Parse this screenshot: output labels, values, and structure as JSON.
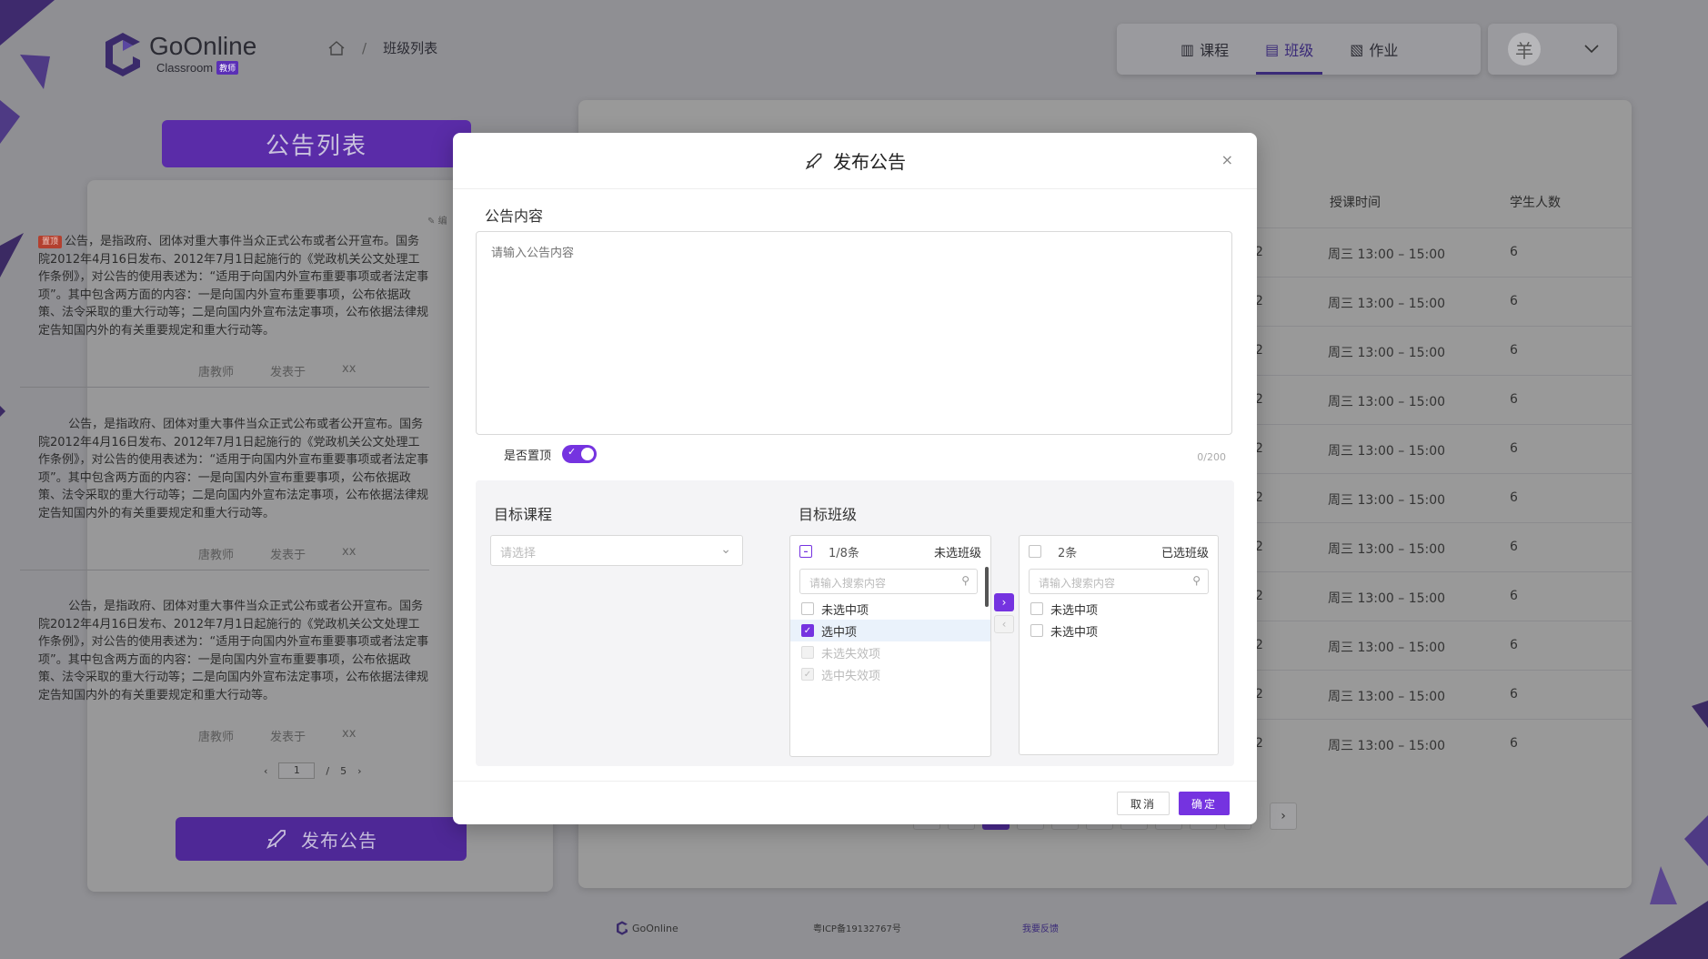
{
  "brand": {
    "name": "GoOnline",
    "sub": "Classroom",
    "role": "教师"
  },
  "breadcrumb": {
    "current": "班级列表"
  },
  "nav": {
    "tabs": [
      {
        "label": "课程",
        "icon": "book-icon"
      },
      {
        "label": "班级",
        "icon": "class-icon",
        "active": true
      },
      {
        "label": "作业",
        "icon": "homework-icon"
      }
    ],
    "avatar_glyph": "羊"
  },
  "left": {
    "title": "公告列表",
    "pinned_label": "置顶",
    "edit_label": "编",
    "items": [
      {
        "pinned": true,
        "text": "公告，是指政府、团体对重大事件当众正式公布或者公开宣布。国务院2012年4月16日发布、2012年7月1日起施行的《党政机关公文处理工作条例》，对公告的使用表述为：“适用于向国内外宣布重要事项或者法定事项”。其中包含两方面的内容：一是向国内外宣布重要事项，公布依据政策、法令采取的重大行动等；二是向国内外宣布法定事项，公布依据法律规定告知国内外的有关重要规定和重大行动等。",
        "author": "唐教师",
        "posted_label": "发表于",
        "time": "xx"
      },
      {
        "pinned": false,
        "text": "        公告，是指政府、团体对重大事件当众正式公布或者公开宣布。国务院2012年4月16日发布、2012年7月1日起施行的《党政机关公文处理工作条例》，对公告的使用表述为：“适用于向国内外宣布重要事项或者法定事项”。其中包含两方面的内容：一是向国内外宣布重要事项，公布依据政策、法令采取的重大行动等；二是向国内外宣布法定事项，公布依据法律规定告知国内外的有关重要规定和重大行动等。",
        "author": "唐教师",
        "posted_label": "发表于",
        "time": "xx"
      },
      {
        "pinned": false,
        "text": "        公告，是指政府、团体对重大事件当众正式公布或者公开宣布。国务院2012年4月16日发布、2012年7月1日起施行的《党政机关公文处理工作条例》，对公告的使用表述为：“适用于向国内外宣布重要事项或者法定事项”。其中包含两方面的内容：一是向国内外宣布重要事项，公布依据政策、法令采取的重大行动等；二是向国内外宣布法定事项，公布依据法律规定告知国内外的有关重要规定和重大行动等。",
        "author": "唐教师",
        "posted_label": "发表于",
        "time": "xx"
      }
    ],
    "pager": {
      "current": "1",
      "sep": "/",
      "total": "5"
    },
    "publish_label": "发布公告"
  },
  "right": {
    "columns": [
      "授课时间",
      "学生人数"
    ],
    "rows": [
      {
        "c0": "2",
        "time": "周三 13:00 – 15:00",
        "count": "6"
      },
      {
        "c0": "2",
        "time": "周三 13:00 – 15:00",
        "count": "6"
      },
      {
        "c0": "2",
        "time": "周三 13:00 – 15:00",
        "count": "6"
      },
      {
        "c0": "2",
        "time": "周三 13:00 – 15:00",
        "count": "6"
      },
      {
        "c0": "2",
        "time": "周三 13:00 – 15:00",
        "count": "6"
      },
      {
        "c0": "2",
        "time": "周三 13:00 – 15:00",
        "count": "6"
      },
      {
        "c0": "2",
        "time": "周三 13:00 – 15:00",
        "count": "6"
      },
      {
        "c0": "2",
        "time": "周三 13:00 – 15:00",
        "count": "6"
      },
      {
        "c0": "2",
        "time": "周三 13:00 – 15:00",
        "count": "6"
      },
      {
        "c0": "2",
        "time": "周三 13:00 – 15:00",
        "count": "6"
      },
      {
        "c0": "2",
        "time": "周三 13:00 – 15:00",
        "count": "6"
      }
    ]
  },
  "footer": {
    "brand": "GoOnline",
    "icp": "粤ICP备19132767号",
    "feedback": "我要反馈"
  },
  "modal": {
    "title": "发布公告",
    "close": "×",
    "content_label": "公告内容",
    "content_placeholder": "请输入公告内容",
    "pin_label": "是否置顶",
    "pin_on": true,
    "counter": "0/200",
    "course_label": "目标课程",
    "course_placeholder": "请选择",
    "class_label": "目标班级",
    "source": {
      "count": "1/8条",
      "title": "未选班级",
      "search_placeholder": "请输入搜索内容",
      "items": [
        {
          "label": "未选中项",
          "state": "off"
        },
        {
          "label": "选中项",
          "state": "on"
        },
        {
          "label": "未选失效项",
          "state": "disabled"
        },
        {
          "label": "选中失效项",
          "state": "disabled-on"
        }
      ]
    },
    "target": {
      "count": "2条",
      "title": "已选班级",
      "search_placeholder": "请输入搜索内容",
      "items": [
        {
          "label": "未选中项",
          "state": "off"
        },
        {
          "label": "未选中项",
          "state": "off"
        }
      ]
    },
    "cancel_label": "取消",
    "ok_label": "确定"
  },
  "colors": {
    "accent": "#7533e0",
    "brand_dark": "#4e2896",
    "overlay_bg": "#8f8f93"
  }
}
